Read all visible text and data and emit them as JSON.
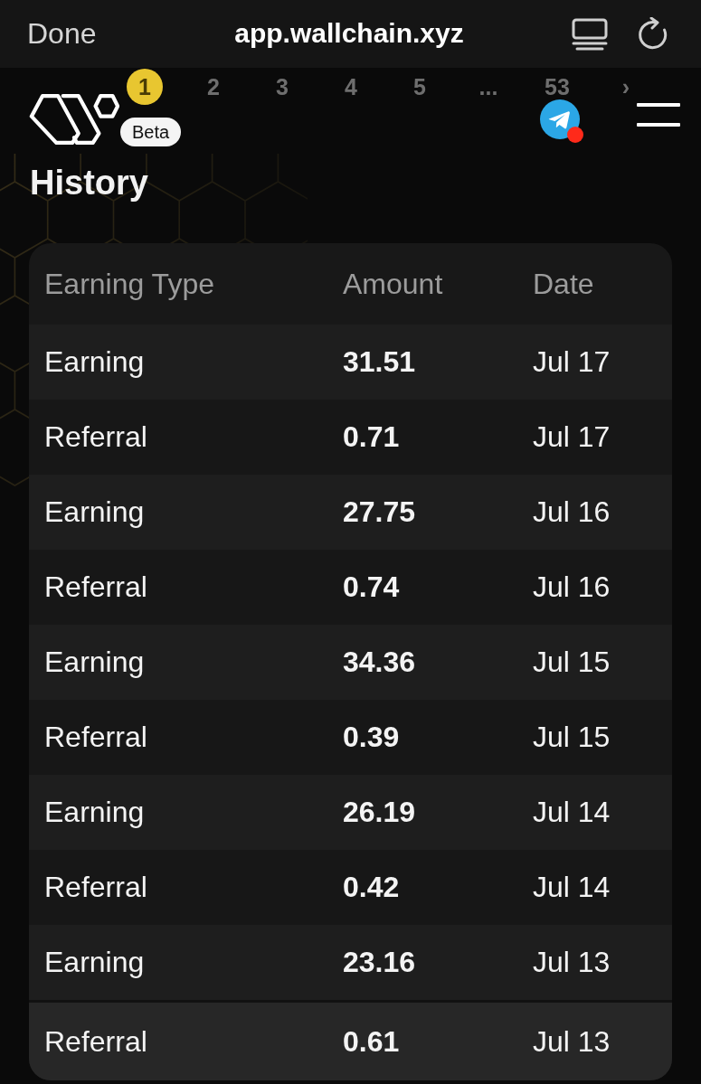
{
  "browser_bar": {
    "done": "Done",
    "url": "app.wallchain.xyz"
  },
  "pagination": {
    "items": [
      {
        "label": "1",
        "selected": true
      },
      {
        "label": "2",
        "selected": false
      },
      {
        "label": "3",
        "selected": false
      },
      {
        "label": "4",
        "selected": false
      },
      {
        "label": "5",
        "selected": false
      },
      {
        "label": "...",
        "selected": false
      },
      {
        "label": "53",
        "selected": false
      },
      {
        "label": "›",
        "selected": false
      }
    ]
  },
  "header": {
    "badge": "Beta",
    "notification": true
  },
  "history": {
    "title": "History",
    "columns": [
      "Earning Type",
      "Amount",
      "Date"
    ],
    "rows": [
      {
        "type": "Earning",
        "amount": "31.51",
        "date": "Jul 17",
        "selected": false
      },
      {
        "type": "Referral",
        "amount": "0.71",
        "date": "Jul 17",
        "selected": false
      },
      {
        "type": "Earning",
        "amount": "27.75",
        "date": "Jul 16",
        "selected": false
      },
      {
        "type": "Referral",
        "amount": "0.74",
        "date": "Jul 16",
        "selected": false
      },
      {
        "type": "Earning",
        "amount": "34.36",
        "date": "Jul 15",
        "selected": false
      },
      {
        "type": "Referral",
        "amount": "0.39",
        "date": "Jul 15",
        "selected": false
      },
      {
        "type": "Earning",
        "amount": "26.19",
        "date": "Jul 14",
        "selected": false
      },
      {
        "type": "Referral",
        "amount": "0.42",
        "date": "Jul 14",
        "selected": false
      },
      {
        "type": "Earning",
        "amount": "23.16",
        "date": "Jul 13",
        "selected": false
      },
      {
        "type": "Referral",
        "amount": "0.61",
        "date": "Jul 13",
        "selected": true
      }
    ]
  }
}
